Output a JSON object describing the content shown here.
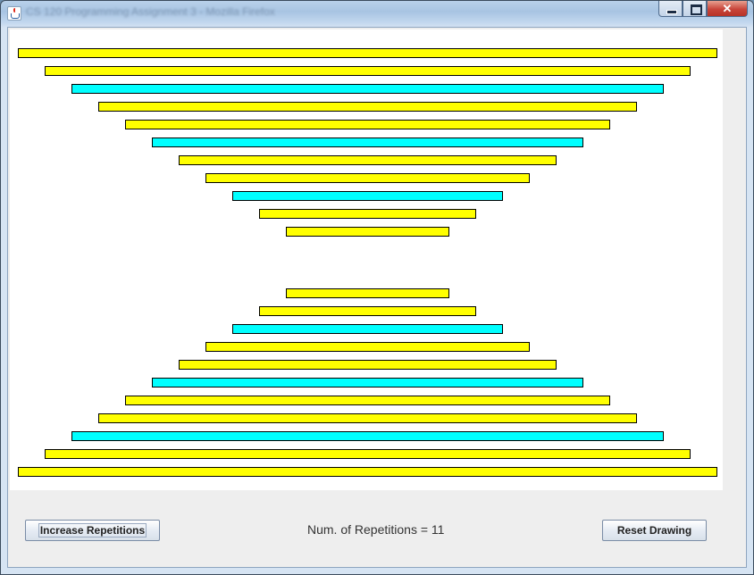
{
  "window": {
    "title": "CS 120 Programming Assignment 3 - Mozilla Firefox",
    "buttons": {
      "minimize": "minimize",
      "maximize": "maximize",
      "close": "✕"
    }
  },
  "colors": {
    "yellow": "#ffff00",
    "cyan": "#00ffff",
    "outline": "#000000"
  },
  "drawing": {
    "repetitions": 11,
    "top_bars": [
      "yellow",
      "yellow",
      "cyan",
      "yellow",
      "yellow",
      "cyan",
      "yellow",
      "yellow",
      "cyan",
      "yellow",
      "yellow"
    ],
    "bottom_bars": [
      "yellow",
      "yellow",
      "cyan",
      "yellow",
      "yellow",
      "cyan",
      "yellow",
      "yellow",
      "cyan",
      "yellow",
      "yellow"
    ]
  },
  "controls": {
    "increase_label": "Increase Repetitions",
    "repetitions_text": "Num. of Repetitions = 11",
    "reset_label": "Reset Drawing"
  }
}
